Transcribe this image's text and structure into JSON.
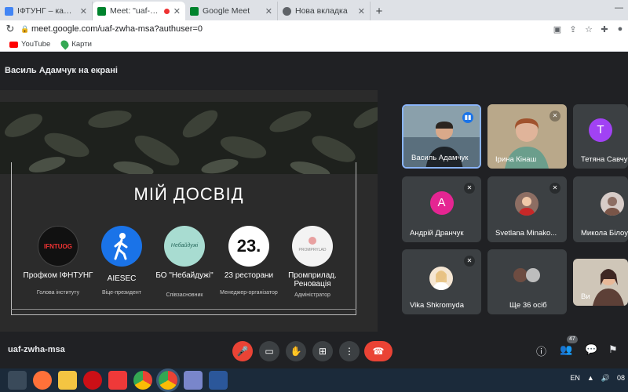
{
  "browser": {
    "tabs": [
      {
        "title": "ІФТУНГ – календар - Деталі по...",
        "color": "#4285f4",
        "active": false,
        "recording": false
      },
      {
        "title": "Meet: \"uaf-zwha-msa\"",
        "color": "#00832d",
        "active": true,
        "recording": true
      },
      {
        "title": "Google Meet",
        "color": "#00832d",
        "active": false,
        "recording": false
      },
      {
        "title": "Нова вкладка",
        "color": "#5f6368",
        "active": false,
        "recording": false
      }
    ],
    "new_tab": "+",
    "url": "meet.google.com/uaf-zwha-msa?authuser=0",
    "bookmarks": [
      {
        "label": "YouTube",
        "icon": "youtube-icon"
      },
      {
        "label": "Карти",
        "icon": "maps-icon"
      }
    ]
  },
  "meet": {
    "presenter_banner": "Василь Адамчук на екрані",
    "meeting_code": "uaf-zwha-msa",
    "participants_count": "47",
    "slide": {
      "title": "МІЙ ДОСВІД",
      "items": [
        {
          "logo": "IFNTUOG",
          "label": "Профком ІФНТУНГ",
          "role": "Голова інституту",
          "color": "#111111"
        },
        {
          "logo": "walking-person-icon",
          "label": "AIESEC",
          "role": "Віце-президент",
          "color": "#1a73e8"
        },
        {
          "logo": "Небайдужі",
          "label": "БО \"Небайдужі\"",
          "role": "Співзасновник",
          "color": "#a8dcd1"
        },
        {
          "logo": "23.",
          "label": "23 ресторани",
          "role": "Менеджер-організатор",
          "color": "#ffffff"
        },
        {
          "logo": "PROMPRYLAD",
          "label": "Промприлад. Реновація",
          "role": "Адміністратор",
          "color": "#f3f3f3"
        }
      ]
    },
    "participants": [
      {
        "name": "Василь Адамчук",
        "type": "video",
        "speaking": true,
        "muted": false
      },
      {
        "name": "Ірина Кінаш",
        "type": "video",
        "speaking": false,
        "muted": true
      },
      {
        "name": "Тетяна Савчу",
        "type": "avatar",
        "initial": "Т",
        "color": "#a142f4",
        "muted": false
      },
      {
        "name": "Андрій Дранчук",
        "type": "avatar",
        "initial": "А",
        "color": "#e52592",
        "muted": true
      },
      {
        "name": "Svetlana Minako...",
        "type": "photo",
        "muted": true
      },
      {
        "name": "Микола Білоу",
        "type": "photo",
        "muted": true
      },
      {
        "name": "Vika Shkromyda",
        "type": "photo",
        "muted": true
      },
      {
        "name": "Ще 36 осіб",
        "type": "group",
        "muted": false
      },
      {
        "name": "Ви",
        "type": "video",
        "muted": false
      }
    ]
  },
  "taskbar": {
    "lang": "EN",
    "time": "08"
  }
}
